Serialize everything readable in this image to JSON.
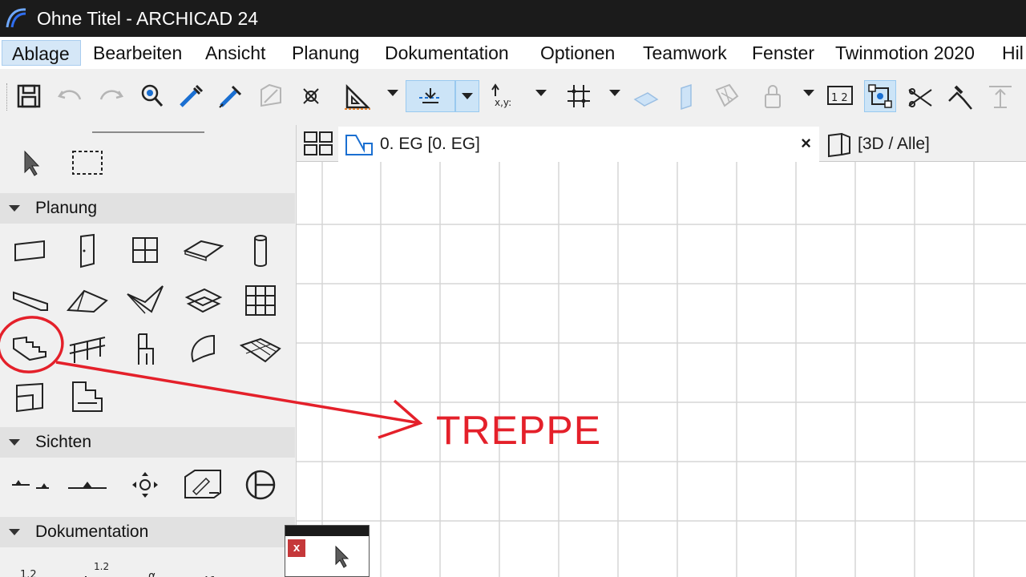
{
  "window": {
    "title": "Ohne Titel - ARCHICAD 24"
  },
  "menu": {
    "items": [
      "Ablage",
      "Bearbeiten",
      "Ansicht",
      "Planung",
      "Dokumentation",
      "Optionen",
      "Teamwork",
      "Fenster",
      "Twinmotion 2020",
      "Hil"
    ],
    "active": "Ablage"
  },
  "toolbar": {
    "icons": [
      "save-icon",
      "undo-icon",
      "redo-icon",
      "find-select-icon",
      "pick-up-parameters-icon",
      "inject-parameters-icon",
      "magic-wand-icon",
      "element-snap-icon",
      "guide-line-icon",
      "gravity-icon",
      "coordinate-input-icon",
      "grid-snap-icon",
      "surface-icon",
      "trace-icon",
      "layer-icon",
      "lock-icon",
      "dimension-icon",
      "suspend-groups-icon",
      "trim-icon",
      "adjust-icon",
      "elevate-icon"
    ]
  },
  "toolbox": {
    "sections": [
      "Planung",
      "Sichten",
      "Dokumentation"
    ],
    "planung_tools": [
      "wall-tool-icon",
      "door-tool-icon",
      "window-tool-icon",
      "slab-tool-icon",
      "column-tool-icon",
      "beam-tool-icon",
      "roof-tool-icon",
      "shell-tool-icon",
      "skylight-tool-icon",
      "curtain-wall-tool-icon",
      "stair-tool-icon",
      "railing-tool-icon",
      "object-tool-icon",
      "morph-tool-icon",
      "mesh-tool-icon",
      "zone-tool-icon",
      "stair-schema-tool-icon"
    ],
    "sichten_tools": [
      "section-tool-icon",
      "elevation-tool-icon",
      "interior-elevation-tool-icon",
      "worksheet-tool-icon",
      "detail-tool-icon"
    ]
  },
  "tabs": {
    "plan": "0. EG [0. EG]",
    "close_symbol": "×",
    "view3d": "[3D / Alle]"
  },
  "floating_palette": {
    "close_symbol": "x"
  },
  "annotation": {
    "label": "TREPPE",
    "color": "#e4202a"
  },
  "colors": {
    "titlebar": "#1b1b1b",
    "menu_active": "#d5e7f7",
    "toolbar_bg": "#f0f0f0",
    "grid_line": "#d6d6d6"
  }
}
